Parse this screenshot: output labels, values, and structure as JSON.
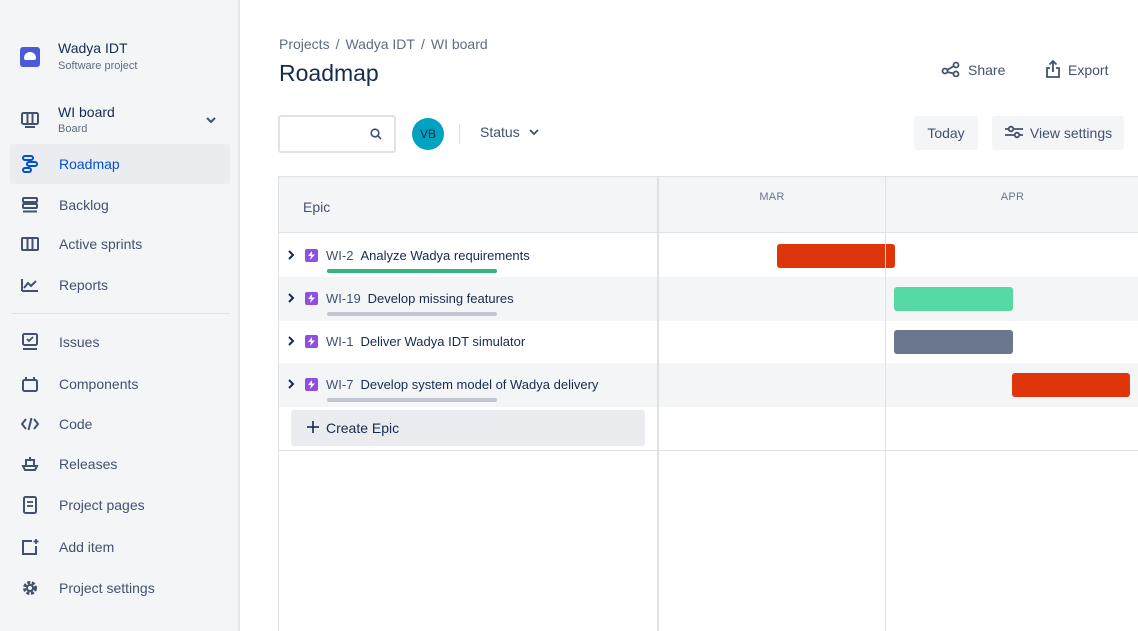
{
  "project": {
    "name": "Wadya IDT",
    "type": "Software project"
  },
  "board": {
    "name": "WI board",
    "type": "Board"
  },
  "nav": {
    "roadmap": "Roadmap",
    "backlog": "Backlog",
    "active_sprints": "Active sprints",
    "reports": "Reports",
    "issues": "Issues",
    "components": "Components",
    "code": "Code",
    "releases": "Releases",
    "project_pages": "Project pages",
    "add_item": "Add item",
    "project_settings": "Project settings"
  },
  "breadcrumb": [
    "Projects",
    "Wadya IDT",
    "WI board"
  ],
  "page_title": "Roadmap",
  "header": {
    "share": "Share",
    "export": "Export"
  },
  "toolbar": {
    "search_placeholder": "",
    "avatar_initials": "VB",
    "status": "Status",
    "today": "Today",
    "view_settings": "View settings"
  },
  "roadmap": {
    "epic_header": "Epic",
    "months": [
      "MAR",
      "APR"
    ],
    "epics": [
      {
        "key": "WI-2",
        "title": "Analyze Wadya requirements",
        "progress": 1.0,
        "bar_color": "#de350b"
      },
      {
        "key": "WI-19",
        "title": "Develop missing features",
        "progress": 0.0,
        "bar_color": "#57d9a3"
      },
      {
        "key": "WI-1",
        "title": "Deliver Wadya IDT simulator",
        "progress": 0.0,
        "bar_color": "#6b778c"
      },
      {
        "key": "WI-7",
        "title": "Develop system model of Wadya delivery",
        "progress": 0.0,
        "bar_color": "#de350b"
      }
    ],
    "create_epic": "Create Epic"
  },
  "colors": {
    "accent": "#0052cc",
    "epic_icon": "#904ee2",
    "avatar": "#00a3bf",
    "progress_done": "#36b37e"
  }
}
